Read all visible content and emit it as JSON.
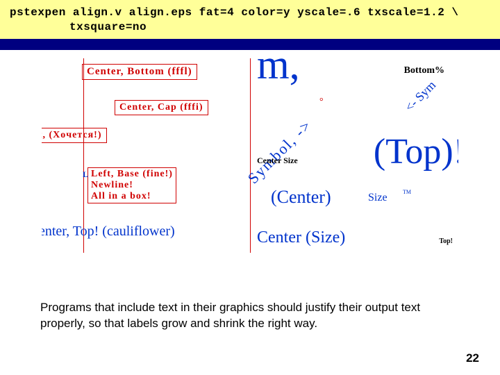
{
  "command": {
    "line1": "pstexpen align.v align.eps fat=4 color=y yscale=.6 txscale=1.2 \\",
    "line2": "txsquare=no"
  },
  "figure": {
    "boxes": {
      "center_bottom": "Center, Bottom (fffl)",
      "center_cap": "Center, Cap (fffi)",
      "ht_xo": "ht, (Xoчется!)",
      "left_base": "Left, Base (fine!)",
      "newline": "Newline!",
      "allbox": "All in a box!"
    },
    "blue": {
      "m_comma": "m,",
      "bottom_pct": "Bottom%",
      "arrow_sym": "<- Sym",
      "symbol_arrow": "Symbol, ->",
      "degree": "°",
      "center_size1": "Center Size",
      "top_excl": "(Top)!",
      "center_size2": "(Center)",
      "size_word": "Size",
      "tm": "TM",
      "center_cauli": "enter, Top! (cauliflower)",
      "center_size3": "Center (Size)",
      "top_small": "Top!"
    }
  },
  "caption": "Programs that include text in their graphics should justify their output text properly, so that labels grow and shrink the right way.",
  "page_number": "22"
}
